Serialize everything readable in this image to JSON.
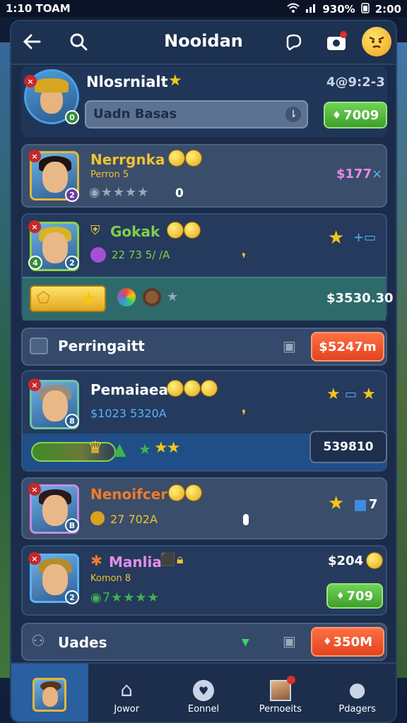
{
  "status_bar": {
    "time": "1:10 TOAM",
    "battery": "930%",
    "clock": "2:00"
  },
  "header": {
    "title": "Nooidan"
  },
  "profile": {
    "name": "Nlosrnialt",
    "score": "4@9:2-3",
    "search_placeholder": "Uadn Basas",
    "button": "7009",
    "badge": "0"
  },
  "items": [
    {
      "name": "Nerrgnka",
      "sub": "Perron 5",
      "rating": "0",
      "price": "$177",
      "name_color": "#f1c232",
      "price_color": "#e58ce8"
    },
    {
      "name": "Gokak",
      "sub": "22 73 5/ /A",
      "name_color": "#7fd14a"
    }
  ],
  "reward_bar": {
    "price": "$3530.30"
  },
  "section1": {
    "title": "Perringaitt",
    "button": "$5247m"
  },
  "item3": {
    "name": "Pemaiaea",
    "sub": "$1023 5320A",
    "price": "539810"
  },
  "item4": {
    "name": "Nenoifcer",
    "sub": "27 702A",
    "badge": "7",
    "name_color": "#f07b2a"
  },
  "item5": {
    "name": "Manlia",
    "sub": "Komon 8",
    "price": "$204",
    "button": "709",
    "name_color": "#e58ce8"
  },
  "section2": {
    "title": "Uades",
    "button": "350M"
  },
  "nav": [
    {
      "label": ""
    },
    {
      "label": "Jowor"
    },
    {
      "label": "Eonnel"
    },
    {
      "label": "Pernoeits"
    },
    {
      "label": "Pdagers"
    }
  ]
}
